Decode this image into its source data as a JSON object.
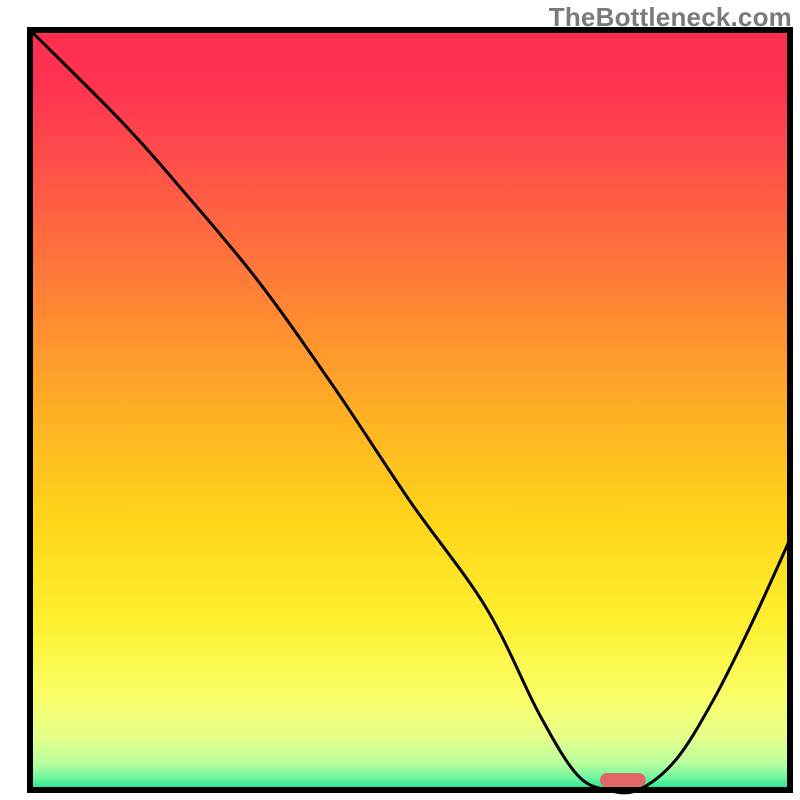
{
  "watermark": "TheBottleneck.com",
  "chart_data": {
    "type": "line",
    "title": "",
    "xlabel": "",
    "ylabel": "",
    "xlim": [
      0,
      100
    ],
    "ylim": [
      0,
      100
    ],
    "series": [
      {
        "name": "bottleneck-curve",
        "x": [
          0,
          12,
          20,
          30,
          40,
          50,
          60,
          67,
          72,
          76,
          80,
          85,
          90,
          95,
          100
        ],
        "y": [
          100,
          88,
          79,
          67,
          53,
          38,
          24,
          10,
          2,
          0,
          0,
          4,
          12,
          22,
          33
        ]
      }
    ],
    "marker": {
      "name": "optimal-range",
      "x_start": 75,
      "x_end": 81,
      "color": "#e36767"
    },
    "gradient_stops": [
      {
        "offset": 0.0,
        "color": "#ff2d4f"
      },
      {
        "offset": 0.08,
        "color": "#ff3450"
      },
      {
        "offset": 0.2,
        "color": "#ff5647"
      },
      {
        "offset": 0.35,
        "color": "#ff8235"
      },
      {
        "offset": 0.5,
        "color": "#ffaf25"
      },
      {
        "offset": 0.65,
        "color": "#ffd61a"
      },
      {
        "offset": 0.78,
        "color": "#fff030"
      },
      {
        "offset": 0.88,
        "color": "#f9ff6a"
      },
      {
        "offset": 0.93,
        "color": "#e6ff8a"
      },
      {
        "offset": 0.965,
        "color": "#b8ff9e"
      },
      {
        "offset": 0.985,
        "color": "#6cf59f"
      },
      {
        "offset": 1.0,
        "color": "#1ee08e"
      }
    ],
    "axis_color": "#000000",
    "curve_color": "#000000",
    "curve_width": 3
  }
}
